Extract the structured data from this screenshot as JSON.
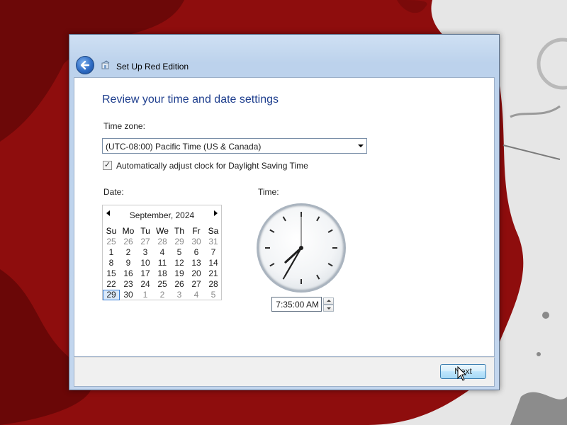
{
  "window": {
    "title": "Set Up Red Edition",
    "back_icon": "back-arrow-icon",
    "setup_icon": "setup-icon"
  },
  "page": {
    "heading": "Review your time and date settings",
    "timezone": {
      "label": "Time zone:",
      "value": "(UTC-08:00) Pacific Time (US & Canada)"
    },
    "dst": {
      "checked": true,
      "label": "Automatically adjust clock for Daylight Saving Time"
    },
    "date": {
      "label": "Date:",
      "month_title": "September, 2024",
      "weekdays": [
        "Su",
        "Mo",
        "Tu",
        "We",
        "Th",
        "Fr",
        "Sa"
      ],
      "weeks": [
        [
          "25",
          "26",
          "27",
          "28",
          "29",
          "30",
          "31"
        ],
        [
          "1",
          "2",
          "3",
          "4",
          "5",
          "6",
          "7"
        ],
        [
          "8",
          "9",
          "10",
          "11",
          "12",
          "13",
          "14"
        ],
        [
          "15",
          "16",
          "17",
          "18",
          "19",
          "20",
          "21"
        ],
        [
          "22",
          "23",
          "24",
          "25",
          "26",
          "27",
          "28"
        ],
        [
          "29",
          "30",
          "1",
          "2",
          "3",
          "4",
          "5"
        ]
      ],
      "selected_day": "29"
    },
    "time": {
      "label": "Time:",
      "value": "7:35:00 AM",
      "hour": 7,
      "minute": 35,
      "second": 0
    }
  },
  "footer": {
    "next_label": "Next"
  },
  "colors": {
    "background_red": "#8e0d0d",
    "heading_blue": "#1f3f8e",
    "selection_blue": "#3a7fd5"
  }
}
